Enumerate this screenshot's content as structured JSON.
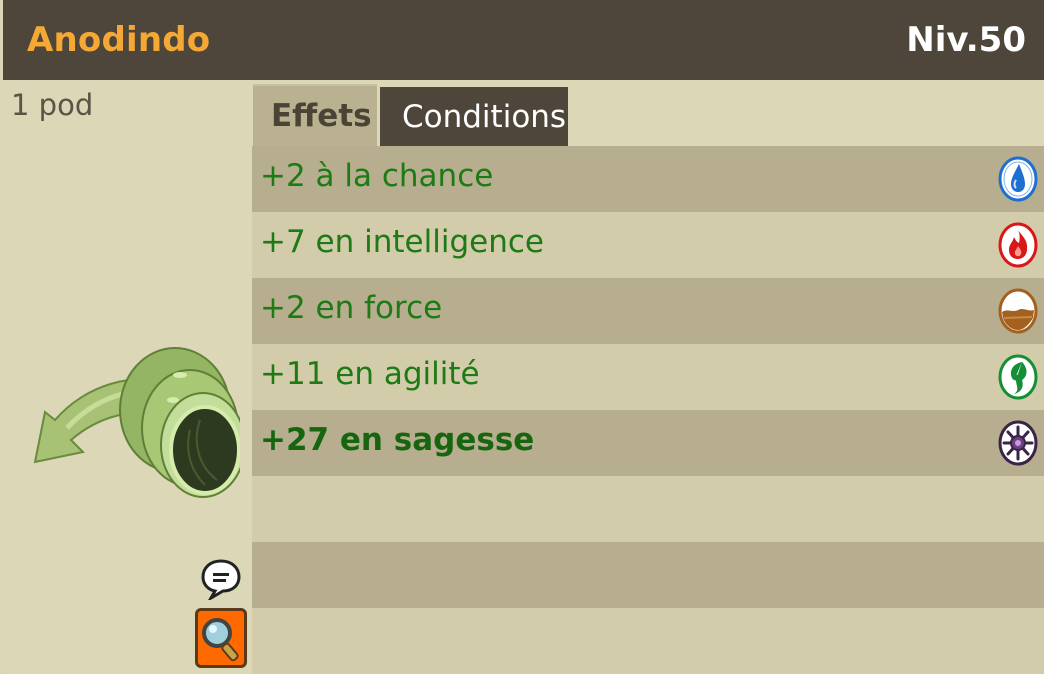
{
  "header": {
    "item_name": "Anodindo",
    "level": "Niv.50"
  },
  "left_panel": {
    "weight": "1 pod",
    "item_image": "green-curled-tube-hat",
    "chat_icon": "speech-bubble-icon",
    "inspect_icon": "magnifier-icon"
  },
  "tabs": [
    {
      "label": "Effets",
      "active": true
    },
    {
      "label": "Conditions",
      "active": false
    }
  ],
  "effects": [
    {
      "text": "+2 à la chance",
      "icon": "water-drop-icon",
      "color": "#1e6fd0"
    },
    {
      "text": "+7 en intelligence",
      "icon": "fire-icon",
      "color": "#d81818"
    },
    {
      "text": "+2 en force",
      "icon": "earth-icon",
      "color": "#a4611e"
    },
    {
      "text": "+11 en agilité",
      "icon": "air-icon",
      "color": "#158f36"
    },
    {
      "text": "+27 en sagesse",
      "icon": "wisdom-icon",
      "color": "#3a2345",
      "bold": true
    }
  ],
  "colors": {
    "title": "#f5a834",
    "effect_text": "#1d7a14",
    "header_bg": "#4e463a"
  }
}
